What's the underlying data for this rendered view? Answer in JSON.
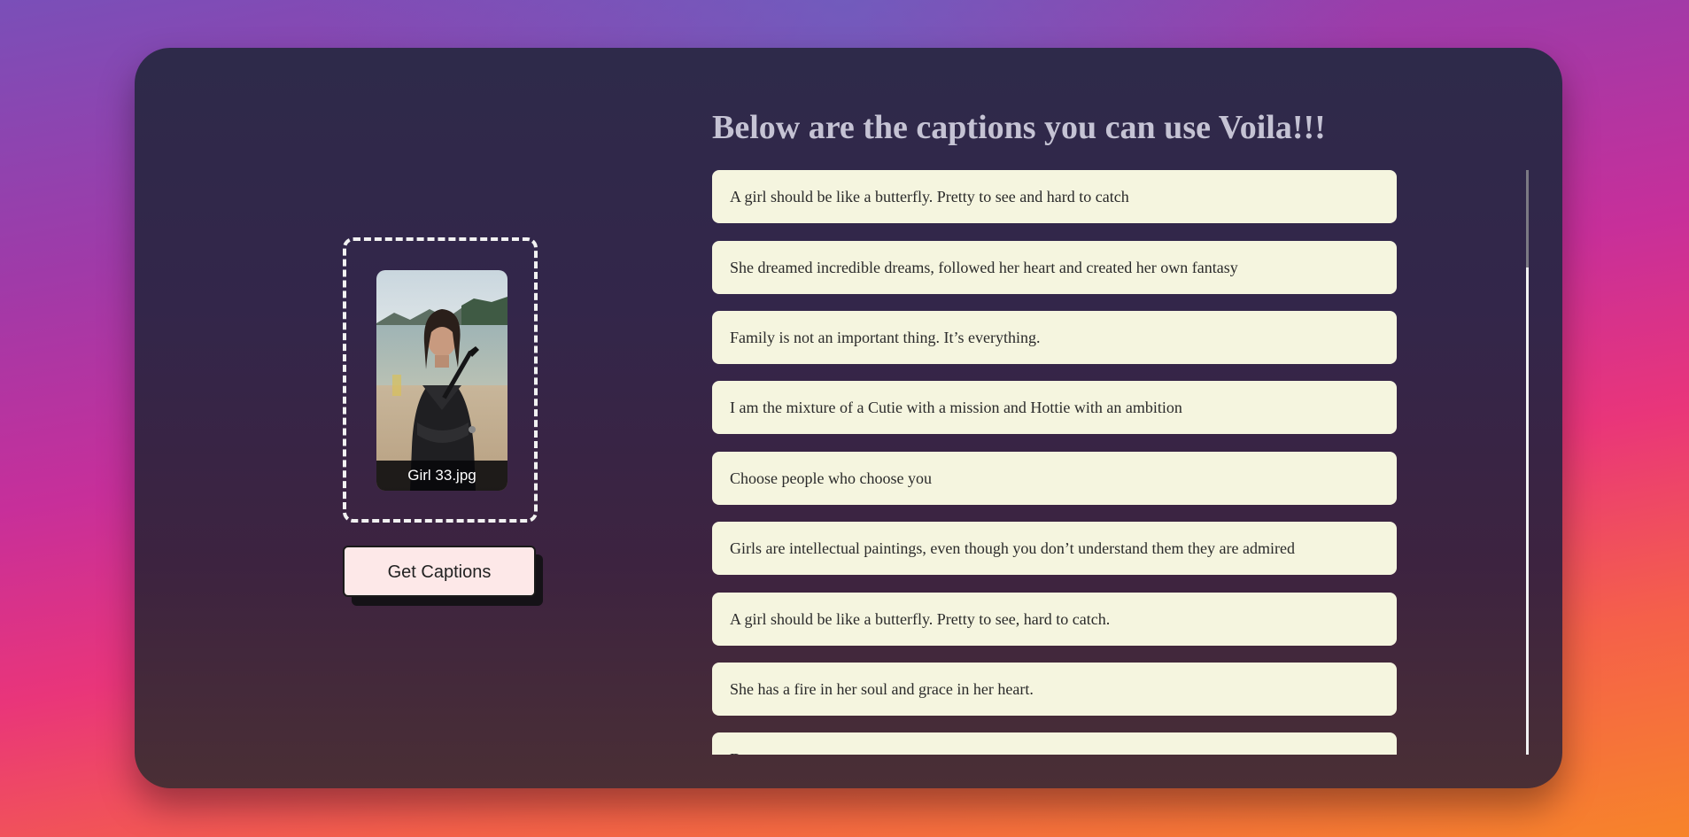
{
  "upload": {
    "file_name": "Girl 33.jpg",
    "button_label": "Get Captions"
  },
  "captions": {
    "heading": "Below are the captions you can use Voila!!!",
    "items": [
      "A girl should be like a butterfly. Pretty to see and hard to catch",
      "She dreamed incredible dreams, followed her heart and created her own fantasy",
      "Family is not an important thing. It’s everything.",
      "I am the mixture of a Cutie with a mission and Hottie with an ambition",
      "Choose people who choose you",
      "Girls are intellectual paintings, even though you don’t understand them they are admired",
      "A girl should be like a butterfly. Pretty to see, hard to catch.",
      "She has a fire in her soul and grace in her heart.",
      "Dream …"
    ]
  },
  "colors": {
    "caption_background": "#f5f5df",
    "button_background": "#fde8e8",
    "heading": "#c5c3d4"
  }
}
